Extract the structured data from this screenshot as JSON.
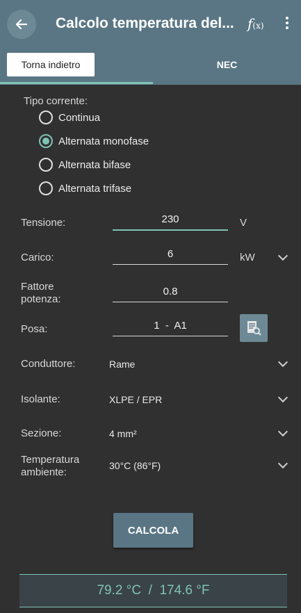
{
  "appbar": {
    "title": "Calcolo temperatura del...",
    "fx_label": "f",
    "fx_sub": "(x)",
    "icons": [
      "back-arrow-icon",
      "function-icon",
      "more-vert-icon"
    ]
  },
  "tabs": [
    {
      "label": "Torna indietro",
      "selected": true
    },
    {
      "label": "NEC",
      "selected": false
    }
  ],
  "form": {
    "tipo_corrente": {
      "label": "Tipo corrente:",
      "options": [
        "Continua",
        "Alternata monofase",
        "Alternata bifase",
        "Alternata trifase"
      ],
      "selected": "Alternata monofase"
    },
    "tensione": {
      "label": "Tensione:",
      "value": "230",
      "unit": "V"
    },
    "carico": {
      "label": "Carico:",
      "value": "6",
      "unit": "kW"
    },
    "fattore": {
      "label_line1": "Fattore",
      "label_line2": "potenza:",
      "value": "0.8"
    },
    "posa": {
      "label": "Posa:",
      "value": "1  -  A1"
    },
    "conduttore": {
      "label": "Conduttore:",
      "value": "Rame"
    },
    "isolante": {
      "label": "Isolante:",
      "value": "XLPE / EPR"
    },
    "sezione": {
      "label": "Sezione:",
      "value": "4 mm²"
    },
    "temperatura": {
      "label_line1": "Temperatura",
      "label_line2": "ambiente:",
      "value": "30°C (86°F)"
    }
  },
  "calc_button": "CALCOLA",
  "result": "79.2 °C  /  174.6 °F",
  "colors": {
    "primary": "#5a7684",
    "accent": "#7fc3b3",
    "background": "#303030"
  }
}
